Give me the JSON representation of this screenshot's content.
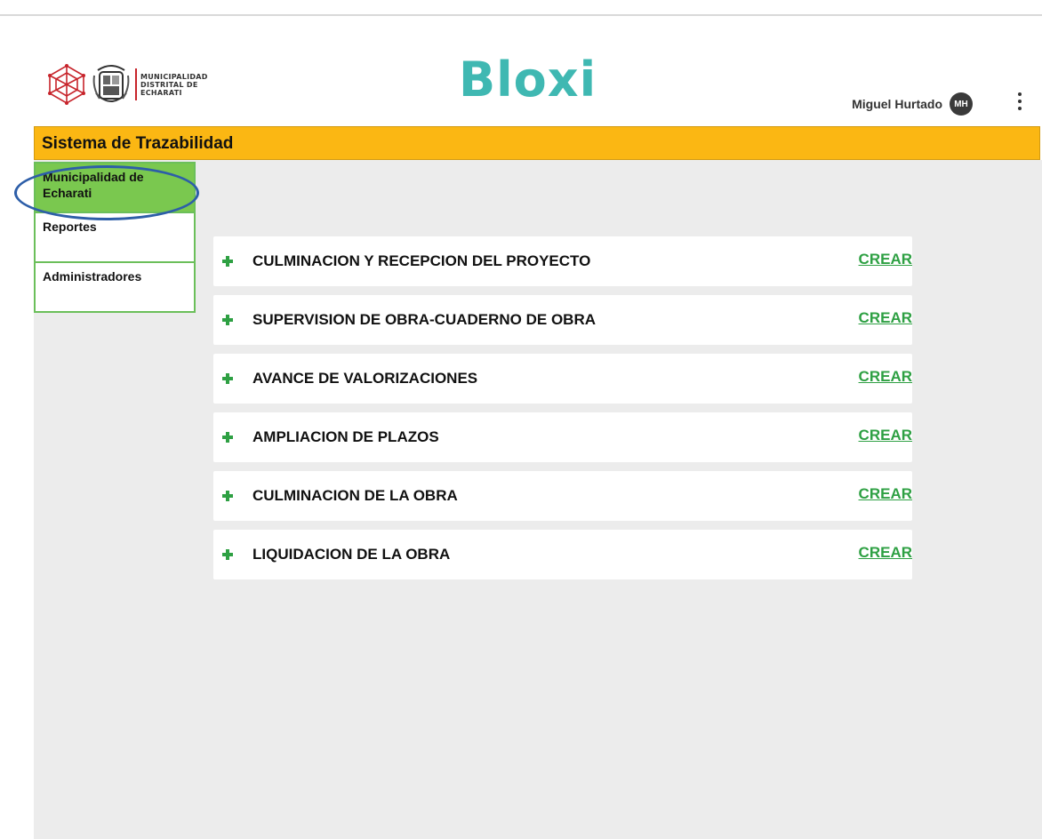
{
  "header": {
    "logo_text": [
      "MUNICIPALIDAD",
      "DISTRITAL DE",
      "ECHARATI"
    ],
    "brand": "Bloxi",
    "user_name": "Miguel Hurtado",
    "user_initials": "MH"
  },
  "titlebar": {
    "title": "Sistema de Trazabilidad"
  },
  "sidebar": {
    "items": [
      {
        "label": "Municipalidad de Echarati",
        "active": true
      },
      {
        "label": "Reportes",
        "active": false
      },
      {
        "label": "Administradores",
        "active": false
      }
    ]
  },
  "tasks": {
    "rows": [
      {
        "label": "CULMINACION Y RECEPCION DEL PROYECTO",
        "action": "CREAR"
      },
      {
        "label": "SUPERVISION DE OBRA-CUADERNO DE OBRA",
        "action": "CREAR"
      },
      {
        "label": "AVANCE DE VALORIZACIONES",
        "action": "CREAR"
      },
      {
        "label": "AMPLIACION DE PLAZOS",
        "action": "CREAR"
      },
      {
        "label": "CULMINACION DE LA OBRA",
        "action": "CREAR"
      },
      {
        "label": "LIQUIDACION DE LA OBRA",
        "action": "CREAR"
      }
    ]
  },
  "colors": {
    "accent_yellow": "#fbb713",
    "sidebar_green": "#7ac84f",
    "action_green": "#2ea043",
    "brand_teal": "#3fb8b2",
    "highlight_blue": "#2d5ea8"
  },
  "icons": {
    "row_icon": "plus-icon",
    "menu": "kebab-menu-icon"
  }
}
